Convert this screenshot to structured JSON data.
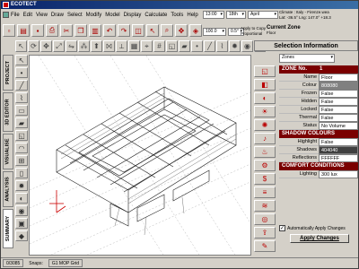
{
  "window": {
    "title": "ECOTECT"
  },
  "menu": [
    "File",
    "Edit",
    "View",
    "Draw",
    "Select",
    "Modify",
    "Model",
    "Display",
    "Calculate",
    "Tools",
    "Help"
  ],
  "time": {
    "clock": "13:00",
    "day": "18th",
    "month": "April"
  },
  "climate": {
    "line1": "Climate : Italy - Firenze.wea",
    "line2": "Lat: -36.5° Lng: 147.0° +18.3"
  },
  "zoom": {
    "value": "100.0",
    "step": "0.5°"
  },
  "apply_to_copy": {
    "line1": "Apply to Copy",
    "line2": "Proportional"
  },
  "current_zone": {
    "title": "Current Zone",
    "name": "Floor"
  },
  "left_tabs": [
    "PROJECT",
    "3D EDITOR",
    "VISUALISE",
    "ANALYSIS",
    "SUMMARY"
  ],
  "status": {
    "count": "0/3085",
    "snaps_label": "Snaps:",
    "snaps": "G1  MOP  Grid"
  },
  "selection_panel": {
    "title": "Selection Information",
    "filter": "Zones",
    "sections": [
      {
        "title": "ZONE No.",
        "number": "1",
        "rows": [
          {
            "label": "Name",
            "value": "Floor"
          },
          {
            "label": "Colour",
            "value": "808080"
          },
          {
            "label": "Frozen",
            "value": "False"
          },
          {
            "label": "Hidden",
            "value": "False"
          },
          {
            "label": "Locked",
            "value": "False"
          },
          {
            "label": "Thermal",
            "value": "False"
          },
          {
            "label": "Status",
            "value": "No Volume"
          }
        ]
      },
      {
        "title": "SHADOW COLOURS",
        "rows": [
          {
            "label": "Highlight",
            "value": "False"
          },
          {
            "label": "Shadows",
            "value": "404040"
          },
          {
            "label": "Reflections",
            "value": "FFFFFF"
          }
        ]
      },
      {
        "title": "COMFORT CONDITIONS",
        "rows": [
          {
            "label": "Lighting",
            "value": "300 lux"
          }
        ]
      }
    ],
    "auto_apply_label": "Automatically Apply Changes",
    "apply_button": "Apply Changes"
  },
  "colors": {
    "titlebar": "#0a246a",
    "section_header": "#7a0000",
    "chrome": "#d4d0c8"
  },
  "icons": {
    "toolbar1": [
      "new-file-icon",
      "open-icon",
      "save-icon",
      "print-icon",
      "cut-icon",
      "copy-icon",
      "paste-icon",
      "undo-icon",
      "redo-icon",
      "cube-icon",
      "pointer-icon",
      "zoom-icon",
      "pan-icon",
      "render-icon"
    ],
    "toolbar2": [
      "select-icon",
      "rotate-icon",
      "move-icon",
      "scale-icon",
      "mirror-icon",
      "array-icon",
      "extrude-icon",
      "join-icon",
      "split-icon",
      "group-icon",
      "snap-icon",
      "grid-icon",
      "zone-icon",
      "plane-icon",
      "point-icon",
      "line-icon",
      "polyline-icon",
      "light-icon",
      "camera-icon",
      "sun-icon"
    ],
    "panel": [
      "zone-icon",
      "material-icon",
      "shading-icon",
      "sun-icon",
      "lighting-icon",
      "acoustic-icon",
      "thermal-icon",
      "resource-icon",
      "cost-icon",
      "report-icon",
      "wind-icon",
      "eye-icon",
      "export-icon",
      "script-icon"
    ]
  }
}
